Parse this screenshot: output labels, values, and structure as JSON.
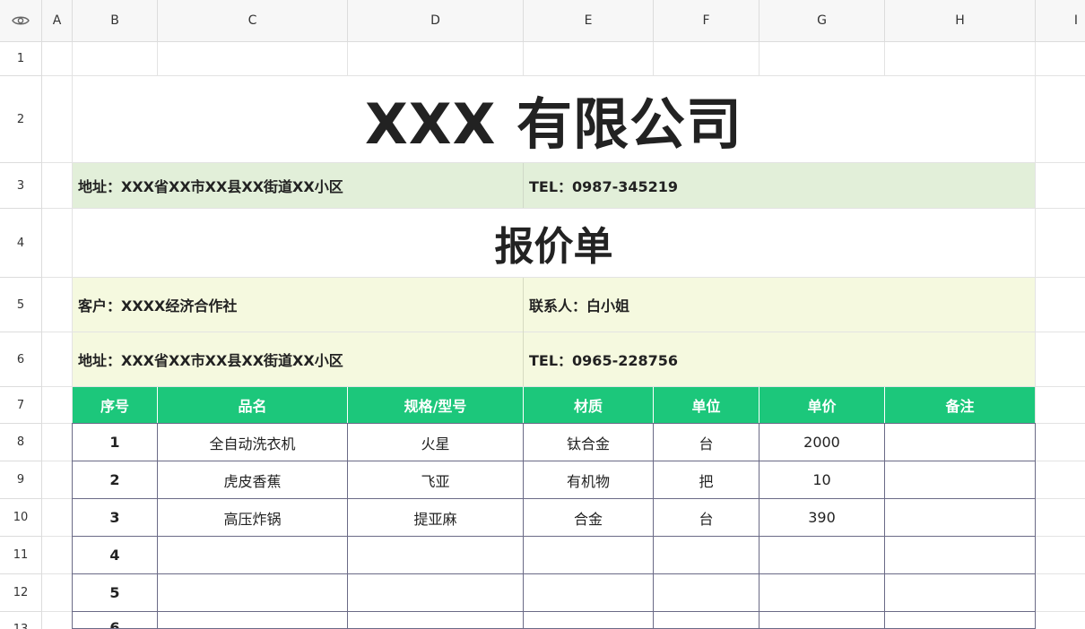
{
  "column_headers": [
    "A",
    "B",
    "C",
    "D",
    "E",
    "F",
    "G",
    "H",
    "I"
  ],
  "row_headers": [
    "1",
    "2",
    "3",
    "4",
    "5",
    "6",
    "7",
    "8",
    "9",
    "10",
    "11",
    "12",
    "13"
  ],
  "icons": {
    "corner": "eye-icon"
  },
  "company": {
    "title": "XXX 有限公司"
  },
  "company_address": "地址：XXX省XX市XX县XX街道XX小区",
  "company_tel": "TEL：0987-345219",
  "doc_title": "报价单",
  "customer": {
    "name": "客户：XXXX经济合作社",
    "contact": "联系人：白小姐",
    "address": "地址：XXX省XX市XX县XX街道XX小区",
    "tel": "TEL：0965-228756"
  },
  "table": {
    "headers": [
      "序号",
      "品名",
      "规格/型号",
      "材质",
      "单位",
      "单价",
      "备注"
    ],
    "rows": [
      [
        "1",
        "全自动洗衣机",
        "火星",
        "钛合金",
        "台",
        "2000",
        ""
      ],
      [
        "2",
        "虎皮香蕉",
        "飞亚",
        "有机物",
        "把",
        "10",
        ""
      ],
      [
        "3",
        "高压炸锅",
        "提亚麻",
        "合金",
        "台",
        "390",
        ""
      ],
      [
        "4",
        "",
        "",
        "",
        "",
        "",
        ""
      ],
      [
        "5",
        "",
        "",
        "",
        "",
        "",
        ""
      ],
      [
        "6",
        "",
        "",
        "",
        "",
        "",
        ""
      ]
    ]
  },
  "colors": {
    "header_green": "#1cc77b",
    "band_green": "#e2efd9",
    "band_yellow": "#f5f9df",
    "table_border": "#6a6a86"
  }
}
